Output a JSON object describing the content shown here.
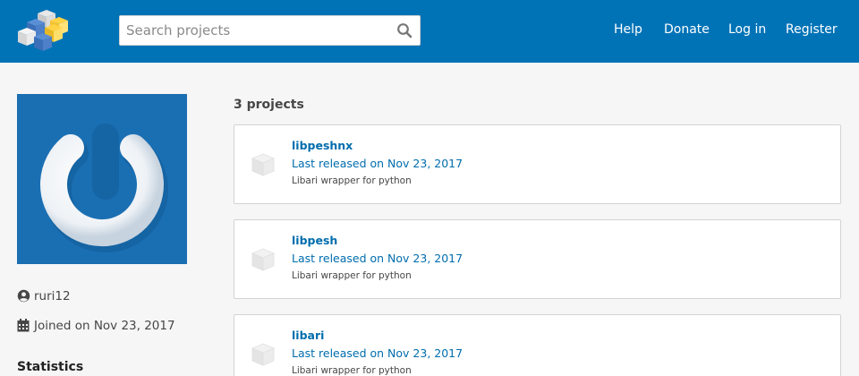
{
  "header": {
    "logo_icon": "pypi-cubes-logo-icon",
    "search": {
      "placeholder": "Search projects",
      "value": "",
      "icon": "search-icon"
    },
    "nav": [
      "Help",
      "Donate",
      "Log in",
      "Register"
    ]
  },
  "profile": {
    "avatar_icon": "gravatar-logo-icon",
    "username": "ruri12",
    "user_icon": "user-circle-icon",
    "joined": "Joined on Nov 23, 2017",
    "calendar_icon": "calendar-icon",
    "statistics_heading": "Statistics"
  },
  "projects": {
    "count_label": "3 projects",
    "package_icon": "package-box-icon",
    "items": [
      {
        "name": "libpeshnx",
        "released": "Last released on Nov 23, 2017",
        "description": "Libari wrapper for python"
      },
      {
        "name": "libpesh",
        "released": "Last released on Nov 23, 2017",
        "description": "Libari wrapper for python"
      },
      {
        "name": "libari",
        "released": "Last released on Nov 23, 2017",
        "description": "Libari wrapper for python"
      }
    ]
  },
  "colors": {
    "header_bg": "#0073b7",
    "link": "#006dad",
    "avatar_bg": "#1a6fb3",
    "page_bg": "#f6f6f6"
  }
}
